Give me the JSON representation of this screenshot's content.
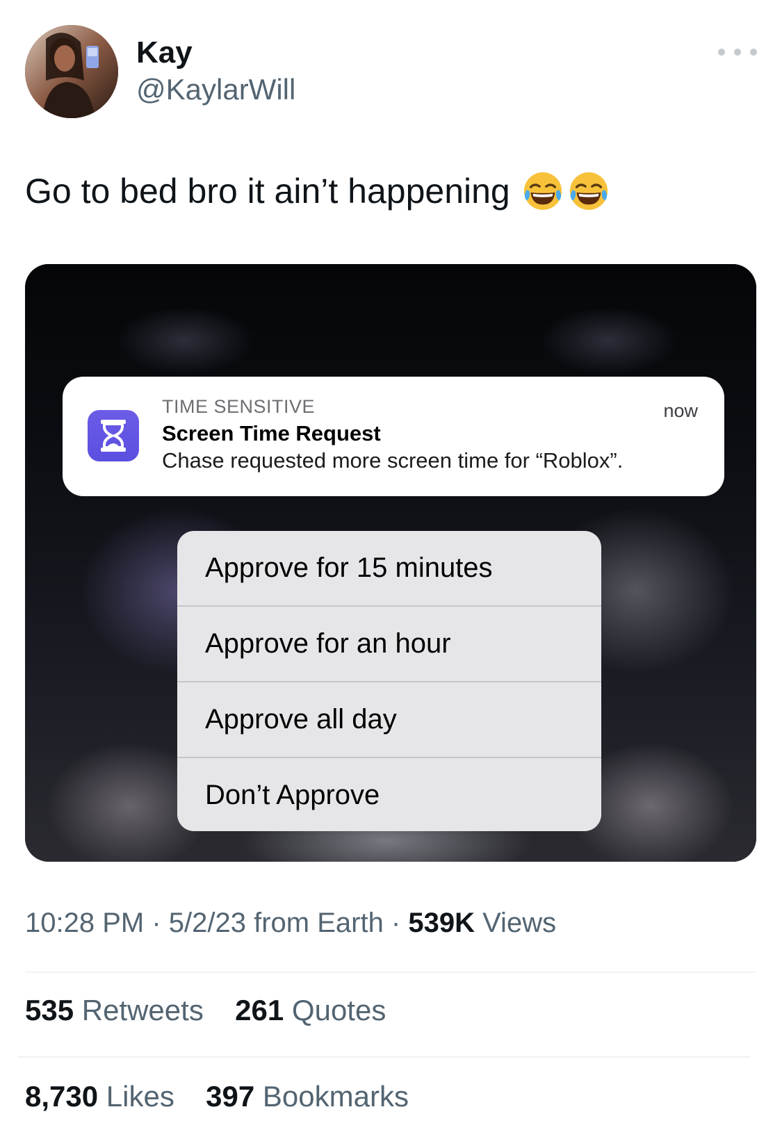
{
  "author": {
    "display_name": "Kay",
    "handle": "@KaylarWill"
  },
  "tweet": {
    "text": "Go to bed bro it ain’t happening",
    "emojis": [
      "face-with-tears-of-joy",
      "face-with-tears-of-joy"
    ]
  },
  "media": {
    "notification": {
      "category": "TIME SENSITIVE",
      "time": "now",
      "title": "Screen Time Request",
      "body": "Chase requested more screen time for “Roblox”.",
      "app_icon": "hourglass-icon",
      "app_icon_color": "#5b4fe0"
    },
    "actions": [
      {
        "label": "Approve for 15 minutes"
      },
      {
        "label": "Approve for an hour"
      },
      {
        "label": "Approve all day"
      },
      {
        "label": "Don’t Approve"
      }
    ]
  },
  "meta": {
    "time": "10:28 PM",
    "sep1": " · ",
    "date_source": "5/2/23 from Earth",
    "sep2": " · ",
    "views_count": "539K",
    "views_label": " Views"
  },
  "stats": {
    "retweets_count": "535",
    "retweets_label": " Retweets",
    "quotes_count": "261",
    "quotes_label": " Quotes",
    "likes_count": "8,730",
    "likes_label": " Likes",
    "bookmarks_count": "397",
    "bookmarks_label": " Bookmarks"
  },
  "colors": {
    "text_primary": "#0f1419",
    "text_secondary": "#536471",
    "divider": "#eff3f4"
  }
}
